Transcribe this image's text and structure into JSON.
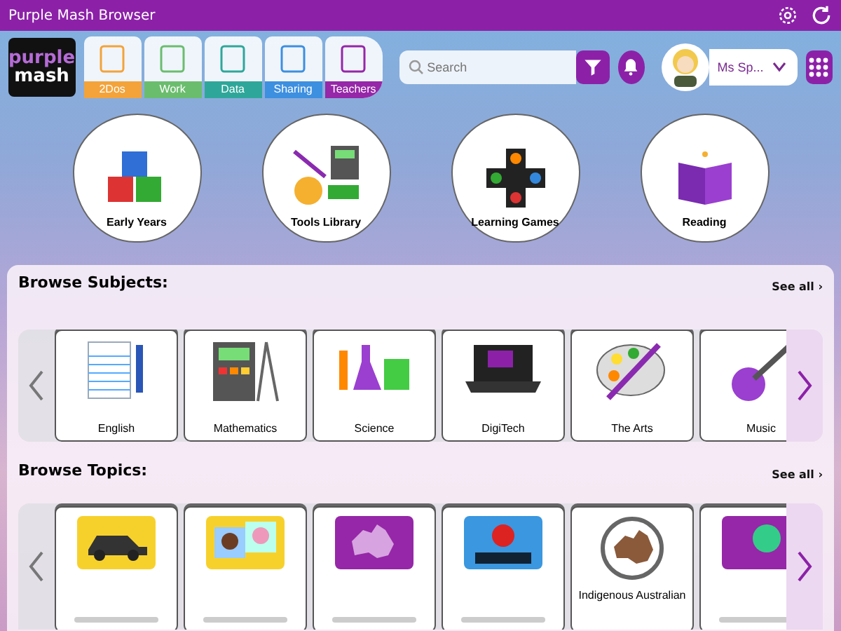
{
  "window": {
    "title": "Purple Mash Browser"
  },
  "logo": {
    "line_1": "purple",
    "line_2": "mash"
  },
  "tabs": [
    {
      "label": "2Dos",
      "color": "#f3a33a"
    },
    {
      "label": "Work",
      "color": "#6bbd6e"
    },
    {
      "label": "Data",
      "color": "#2ea79a"
    },
    {
      "label": "Sharing",
      "color": "#3d8fe0"
    },
    {
      "label": "Teachers",
      "color": "#9627a8"
    }
  ],
  "search": {
    "placeholder": "Search"
  },
  "profile": {
    "name": "Ms Sp..."
  },
  "categories": [
    {
      "label": "Early Years"
    },
    {
      "label": "Tools Library"
    },
    {
      "label": "Learning Games"
    },
    {
      "label": "Reading"
    }
  ],
  "subjects": {
    "title": "Browse Subjects:",
    "see_all": "See all ›",
    "items": [
      {
        "label": "English"
      },
      {
        "label": "Mathematics"
      },
      {
        "label": "Science"
      },
      {
        "label": "DigiTech"
      },
      {
        "label": "The Arts"
      },
      {
        "label": "Music"
      }
    ]
  },
  "topics": {
    "title": "Browse Topics:",
    "see_all": "See all ›",
    "items": [
      {
        "caption_cut": true
      },
      {
        "caption_cut": true
      },
      {
        "caption_cut": true
      },
      {
        "caption_cut": true
      },
      {
        "label": "Indigenous Australian"
      },
      {
        "caption_cut": true
      }
    ]
  }
}
